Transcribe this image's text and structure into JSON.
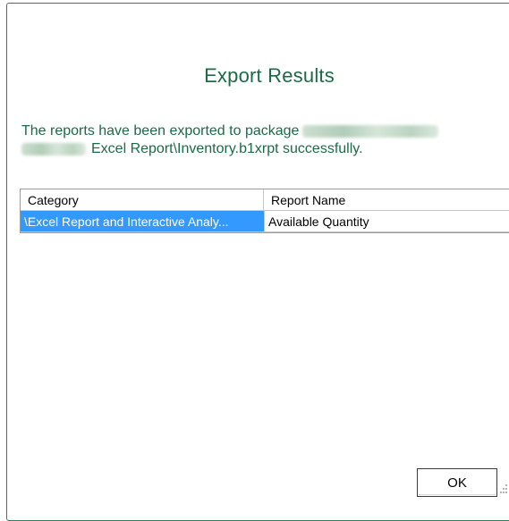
{
  "dialog": {
    "title": "Export Results",
    "message_prefix": "The reports have been exported to package",
    "message_suffix": "Excel Report\\Inventory.b1xrpt successfully."
  },
  "table": {
    "columns": [
      "Category",
      "Report Name"
    ],
    "rows": [
      {
        "category": "\\Excel Report and Interactive Analy...",
        "report_name": "Available Quantity",
        "selected": true
      }
    ]
  },
  "buttons": {
    "ok_label": "OK"
  },
  "colors": {
    "title": "#1b6b45",
    "selection": "#3399ff",
    "border": "#2e7d5b"
  }
}
